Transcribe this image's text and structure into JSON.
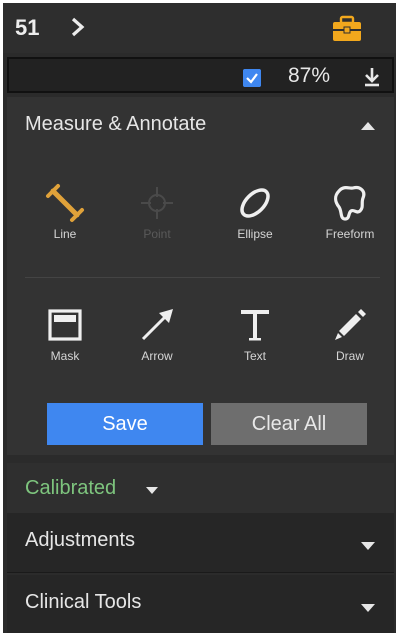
{
  "topbar": {
    "page_number": "51"
  },
  "zoombar": {
    "zoom": "87%"
  },
  "measure": {
    "title": "Measure & Annotate",
    "tools": [
      {
        "label": "Line",
        "icon": "ruler-icon",
        "enabled": true
      },
      {
        "label": "Point",
        "icon": "crosshair-icon",
        "enabled": false
      },
      {
        "label": "Ellipse",
        "icon": "ellipse-icon",
        "enabled": true
      },
      {
        "label": "Freeform",
        "icon": "freeform-icon",
        "enabled": true
      },
      {
        "label": "Mask",
        "icon": "mask-icon",
        "enabled": true
      },
      {
        "label": "Arrow",
        "icon": "arrow-icon",
        "enabled": true
      },
      {
        "label": "Text",
        "icon": "text-icon",
        "enabled": true
      },
      {
        "label": "Draw",
        "icon": "pencil-icon",
        "enabled": true
      }
    ],
    "save_label": "Save",
    "clear_label": "Clear All"
  },
  "calibration": {
    "label": "Calibrated"
  },
  "sections": {
    "adjustments": "Adjustments",
    "clinical": "Clinical Tools"
  },
  "colors": {
    "accent": "#3f87f0",
    "tool_active": "#e0a23a",
    "calibrated": "#7ec57e",
    "toolbox": "#f2a81d"
  }
}
